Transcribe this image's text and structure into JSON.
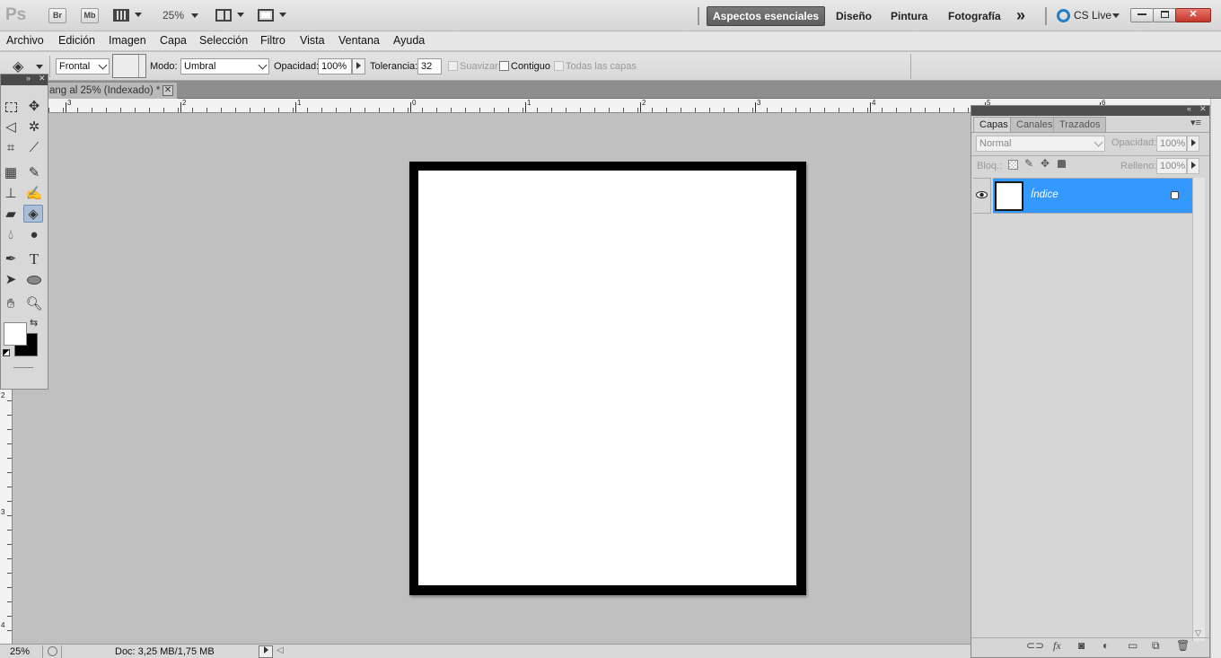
{
  "appbar": {
    "logo": "Ps",
    "bridge": "Br",
    "minibridge": "Mb",
    "zoom": "25%",
    "workspaces": [
      "Aspectos esenciales",
      "Diseño",
      "Pintura",
      "Fotografía"
    ],
    "more": "»",
    "cs_live": "CS Live"
  },
  "menu": [
    "Archivo",
    "Edición",
    "Imagen",
    "Capa",
    "Selección",
    "Filtro",
    "Vista",
    "Ventana",
    "Ayuda"
  ],
  "options": {
    "fill_source": "Frontal",
    "mode_label": "Modo:",
    "mode_value": "Umbral",
    "opacity_label": "Opacidad:",
    "opacity_value": "100%",
    "tolerance_label": "Tolerancia:",
    "tolerance_value": "32",
    "antialias_label": "Suavizar",
    "contiguous_label": "Contiguo",
    "all_layers_label": "Todas las capas"
  },
  "document_tab": {
    "title": "ang al 25% (Indexado) *"
  },
  "rulers": {
    "top": [
      "3",
      "2",
      "1",
      "0",
      "1",
      "2",
      "3",
      "4",
      "5",
      "6"
    ],
    "left": [
      "2",
      "3",
      "4"
    ]
  },
  "layers_panel": {
    "tabs": [
      "Capas",
      "Canales",
      "Trazados"
    ],
    "blend_mode": "Normal",
    "opacity_label": "Opacidad:",
    "opacity_value": "100%",
    "lock_label": "Bloq.:",
    "fill_label": "Relleno:",
    "fill_value": "100%",
    "layers": [
      {
        "name": "Índice",
        "visible": true,
        "locked": true,
        "selected": true
      }
    ]
  },
  "status": {
    "zoom": "25%",
    "doc_info": "Doc: 3,25 MB/1,75 MB"
  },
  "colors": {
    "selection": "#3399ff",
    "foreground": "#ffffff",
    "background": "#000000"
  }
}
